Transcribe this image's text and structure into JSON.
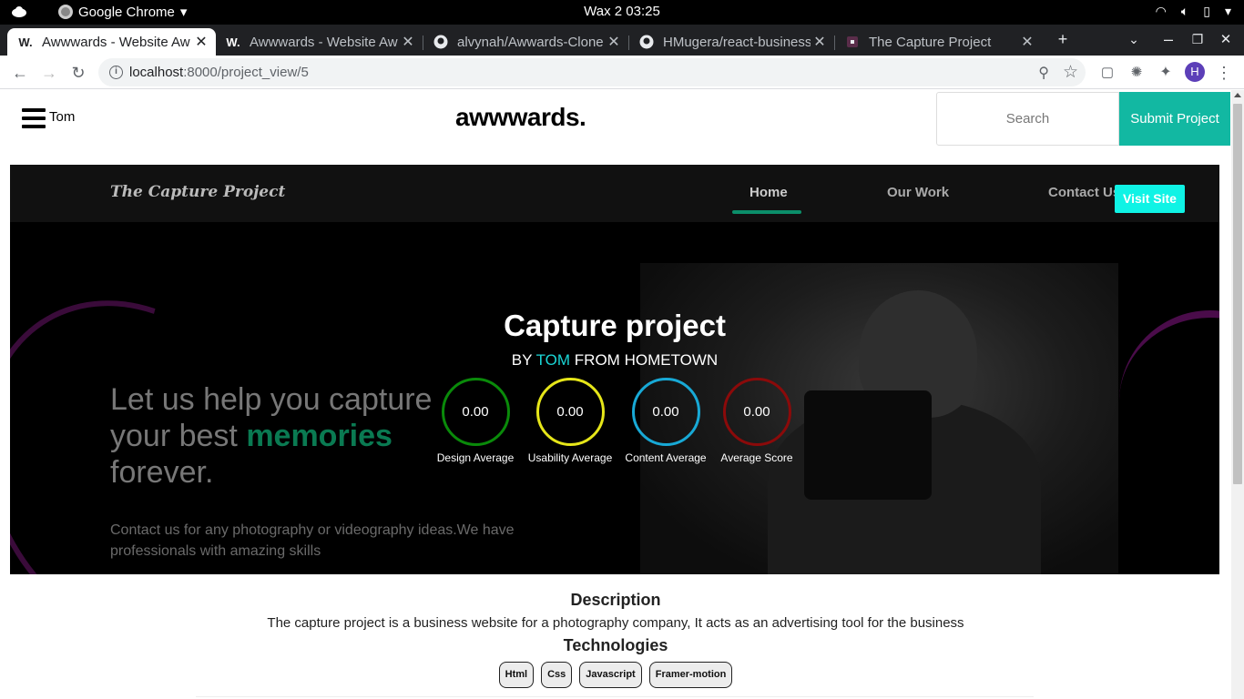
{
  "os": {
    "app_name": "Google Chrome",
    "clock": "Wax 2  03:25"
  },
  "tabs": [
    {
      "favicon": "W.",
      "title": "Awwwards - Website Aw",
      "active": true
    },
    {
      "favicon": "W.",
      "title": "Awwwards - Website Aw",
      "active": false
    },
    {
      "favicon": "github-icon",
      "title": "alvynah/Awwards-Clone",
      "active": false
    },
    {
      "favicon": "github-icon",
      "title": "HMugera/react-business",
      "active": false
    },
    {
      "favicon": "page-icon",
      "title": "The Capture Project",
      "active": false
    }
  ],
  "toolbar": {
    "url_host": "localhost",
    "url_path": ":8000/project_view/5",
    "profile_initial": "H"
  },
  "header": {
    "user": "Tom",
    "brand": "awwwards.",
    "search_placeholder": "Search",
    "submit_label": "Submit Project"
  },
  "hero": {
    "site_logo": "The Capture Project",
    "nav": [
      "Home",
      "Our Work",
      "Contact Us"
    ],
    "visit_label": "Visit Site",
    "tagline_1": "Let us help you capture your best",
    "tagline_highlight": "memories",
    "tagline_2": "forever.",
    "contact_text": "Contact us for any photography or videography ideas.We have professionals with amazing skills"
  },
  "project": {
    "title": "Capture project",
    "by_prefix": "BY",
    "author": "TOM",
    "by_suffix": "FROM HOMETOWN",
    "scores": [
      {
        "value": "0.00",
        "label": "Design Average",
        "color": "#0a8a0a"
      },
      {
        "value": "0.00",
        "label": "Usability Average",
        "color": "#e6e619"
      },
      {
        "value": "0.00",
        "label": "Content Average",
        "color": "#18a9d6"
      },
      {
        "value": "0.00",
        "label": "Average Score",
        "color": "#8b0a0a"
      }
    ],
    "description_heading": "Description",
    "description": "The capture project is a business website for a photography company, It acts as an advertising tool for the business",
    "technologies_heading": "Technologies",
    "technologies": [
      "Html",
      "Css",
      "Javascript",
      "Framer-motion"
    ]
  }
}
